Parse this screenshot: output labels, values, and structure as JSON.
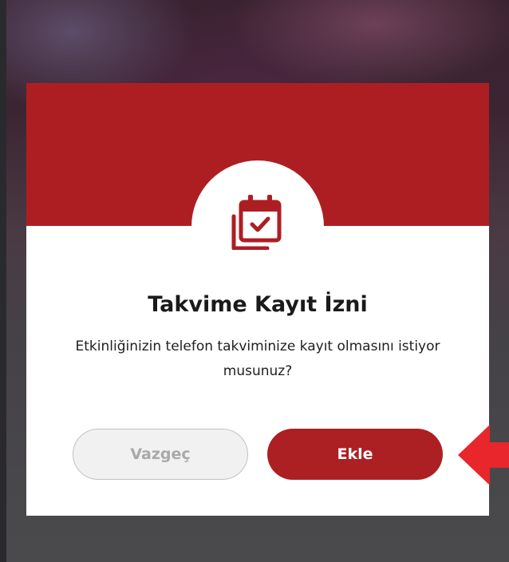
{
  "dialog": {
    "title": "Takvime Kayıt İzni",
    "message": "Etkinliğinizin telefon takviminize kayıt olmasını istiyor musunuz?",
    "cancel_label": "Vazgeç",
    "confirm_label": "Ekle",
    "icon": "calendar-check-icon"
  },
  "colors": {
    "brand_red": "#ad1e23",
    "pointer_arrow": "#e8262b"
  }
}
